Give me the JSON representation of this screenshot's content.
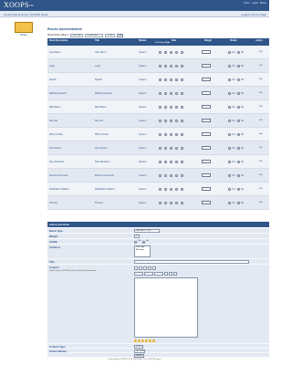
{
  "header": {
    "logo_text": "XOOPS",
    "logo_tm": "TM",
    "toplinks": [
      "Home",
      "Logout",
      "Blocks"
    ]
  },
  "nav": {
    "left_label": "Control Panel Home | XOOPS News",
    "right_label": "Logout | Home Page"
  },
  "sidebar": {
    "module_label": "Blocks"
  },
  "blocks_admin": {
    "title": "Blocks Administration",
    "filter_label": "Show blocks visible in",
    "filter_value": "Top Page",
    "group_value": "Webmasters",
    "visible_value": "Visible",
    "go_label": "Go",
    "columns": [
      "Block Description",
      "Title",
      "Module",
      "Side",
      "Left Center Right",
      "Weight",
      "Visible",
      "Action"
    ],
    "rows": [
      {
        "description": "User Menu",
        "title": "User Menu",
        "module": "System"
      },
      {
        "description": "Login",
        "title": "Login",
        "module": "System"
      },
      {
        "description": "Search",
        "title": "Search",
        "module": "System"
      },
      {
        "description": "Waiting Contents",
        "title": "Waiting Contents",
        "module": "System"
      },
      {
        "description": "Main Menu",
        "title": "Main Menu",
        "module": "System"
      },
      {
        "description": "Site Info",
        "title": "Site Info",
        "module": "System"
      },
      {
        "description": "Who's Online",
        "title": "Who's Online",
        "module": "System"
      },
      {
        "description": "Top Posters",
        "title": "Top Posters",
        "module": "System"
      },
      {
        "description": "New Members",
        "title": "New Members",
        "module": "System"
      },
      {
        "description": "Recent Comments",
        "title": "Recent Comments",
        "module": "System"
      },
      {
        "description": "Notification Options",
        "title": "Notification Options",
        "module": "System"
      },
      {
        "description": "Themes",
        "title": "Themes",
        "module": "System"
      }
    ],
    "yes_label": "Yes",
    "no_label": "No",
    "edit_label": "Edit"
  },
  "add_block": {
    "title": "Add a new block",
    "block_type_label": "Block Type",
    "block_type_value": "Side Block - Left",
    "weight_label": "Weight",
    "weight_value": "0",
    "visible_label": "Visible",
    "visible_in_label": "Visible in",
    "visible_in_options": [
      "Top Page",
      "All Pages"
    ],
    "title_label": "Title",
    "content_label": "Content",
    "content_hint": "Useful Tags: {X_SITEURL} will print http://localhost/xoops/",
    "content_type_label": "Content Type",
    "content_type_value": "HTML",
    "cache_label": "Cache lifetime",
    "cache_value": "No Cache",
    "submit_label": "Submit"
  },
  "footer": {
    "text": "Powered by XOOPS 2.0 (c) 2001-2007 The XOOPS Project"
  }
}
